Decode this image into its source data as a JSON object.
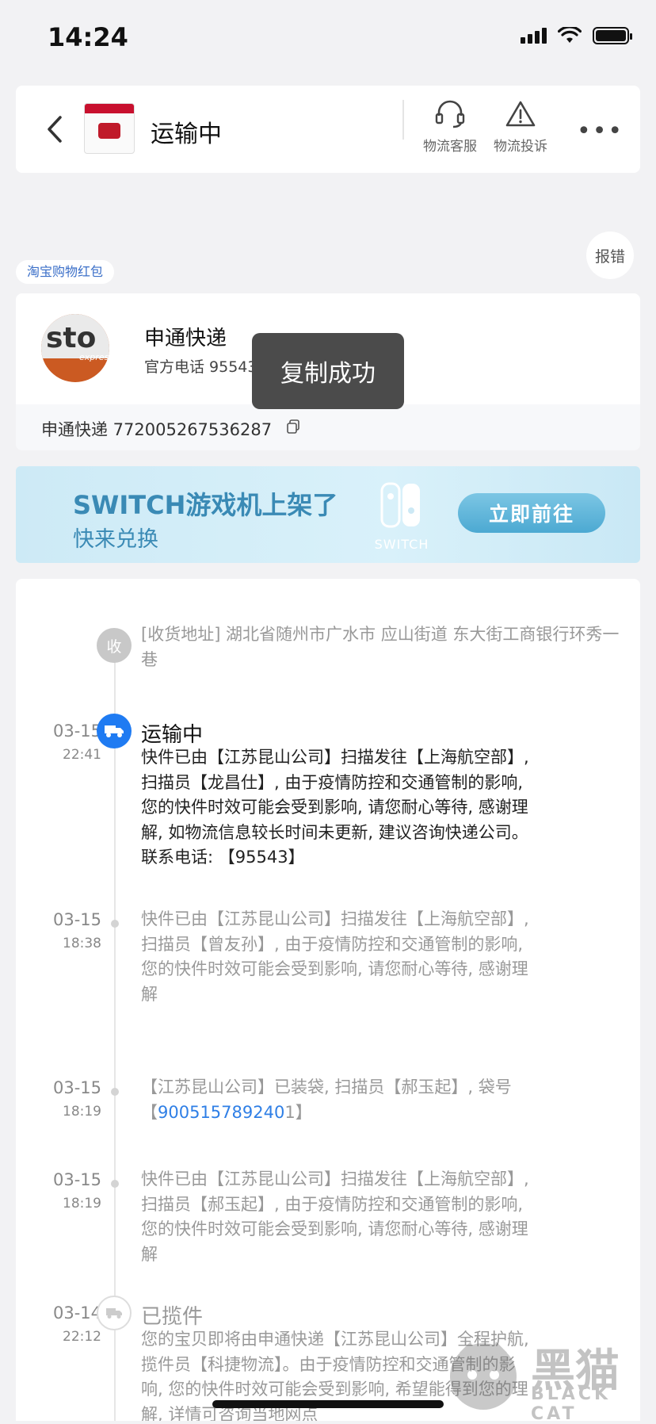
{
  "status_bar": {
    "time": "14:24",
    "battery_level": 0.9,
    "signal_bars": 4
  },
  "header": {
    "title": "运输中",
    "buttons": [
      {
        "label": "物流客服",
        "icon": "headset-icon"
      },
      {
        "label": "物流投诉",
        "icon": "warning-icon"
      }
    ],
    "more": "•••"
  },
  "report_label": "报错",
  "redpack_label": "淘宝购物红包",
  "courier": {
    "logo_word": "sto",
    "logo_sub": "express",
    "name": "申通快递",
    "phone": "官方电话 95543 >",
    "tracking": "申通快递 772005267536287"
  },
  "toast": "复制成功",
  "banner": {
    "title": "SWITCH游戏机上架了",
    "subtitle": "快来兑换",
    "logo_word": "SWITCH",
    "button": "立即前往"
  },
  "timeline": {
    "address_badge": "收",
    "address": "[收货地址] 湖北省随州市广水市  应山街道   东大街工商银行环秀一巷",
    "events": [
      {
        "date": "03-15",
        "time": "22:41",
        "status": "运输中",
        "lines": [
          "快件已由【江苏昆山公司】扫描发往【上海航空部】,",
          "扫描员【龙昌仕】, 由于疫情防控和交通管制的影响,",
          "您的快件时效可能会受到影响, 请您耐心等待, 感谢理",
          "解, 如物流信息较长时间未更新, 建议咨询快递公司。",
          "联系电话: 【95543】"
        ]
      },
      {
        "date": "03-15",
        "time": "18:38",
        "lines": [
          "快件已由【江苏昆山公司】扫描发往【上海航空部】,",
          "扫描员【曾友孙】, 由于疫情防控和交通管制的影响,",
          "您的快件时效可能会受到影响, 请您耐心等待, 感谢理",
          "解"
        ]
      },
      {
        "date": "03-15",
        "time": "18:19",
        "line1": "【江苏昆山公司】已装袋, 扫描员【郝玉起】, 袋号",
        "bag_prefix": "【",
        "bag_number": "900515789240",
        "bag_suffix": "1】"
      },
      {
        "date": "03-15",
        "time": "18:19",
        "lines": [
          "快件已由【江苏昆山公司】扫描发往【上海航空部】,",
          "扫描员【郝玉起】, 由于疫情防控和交通管制的影响,",
          "您的快件时效可能会受到影响, 请您耐心等待, 感谢理",
          "解"
        ]
      },
      {
        "date": "03-14",
        "time": "22:12",
        "status": "已揽件",
        "lines": [
          "您的宝贝即将由申通快递【江苏昆山公司】全程护航,",
          "揽件员【科捷物流】。由于疫情防控和交通管制的影",
          "响, 您的快件时效可能会受到影响, 希望能得到您的理",
          "解, 详情可咨询当地网点"
        ]
      }
    ]
  },
  "watermark": {
    "text": "黑猫",
    "sub": "BLACK CAT"
  }
}
